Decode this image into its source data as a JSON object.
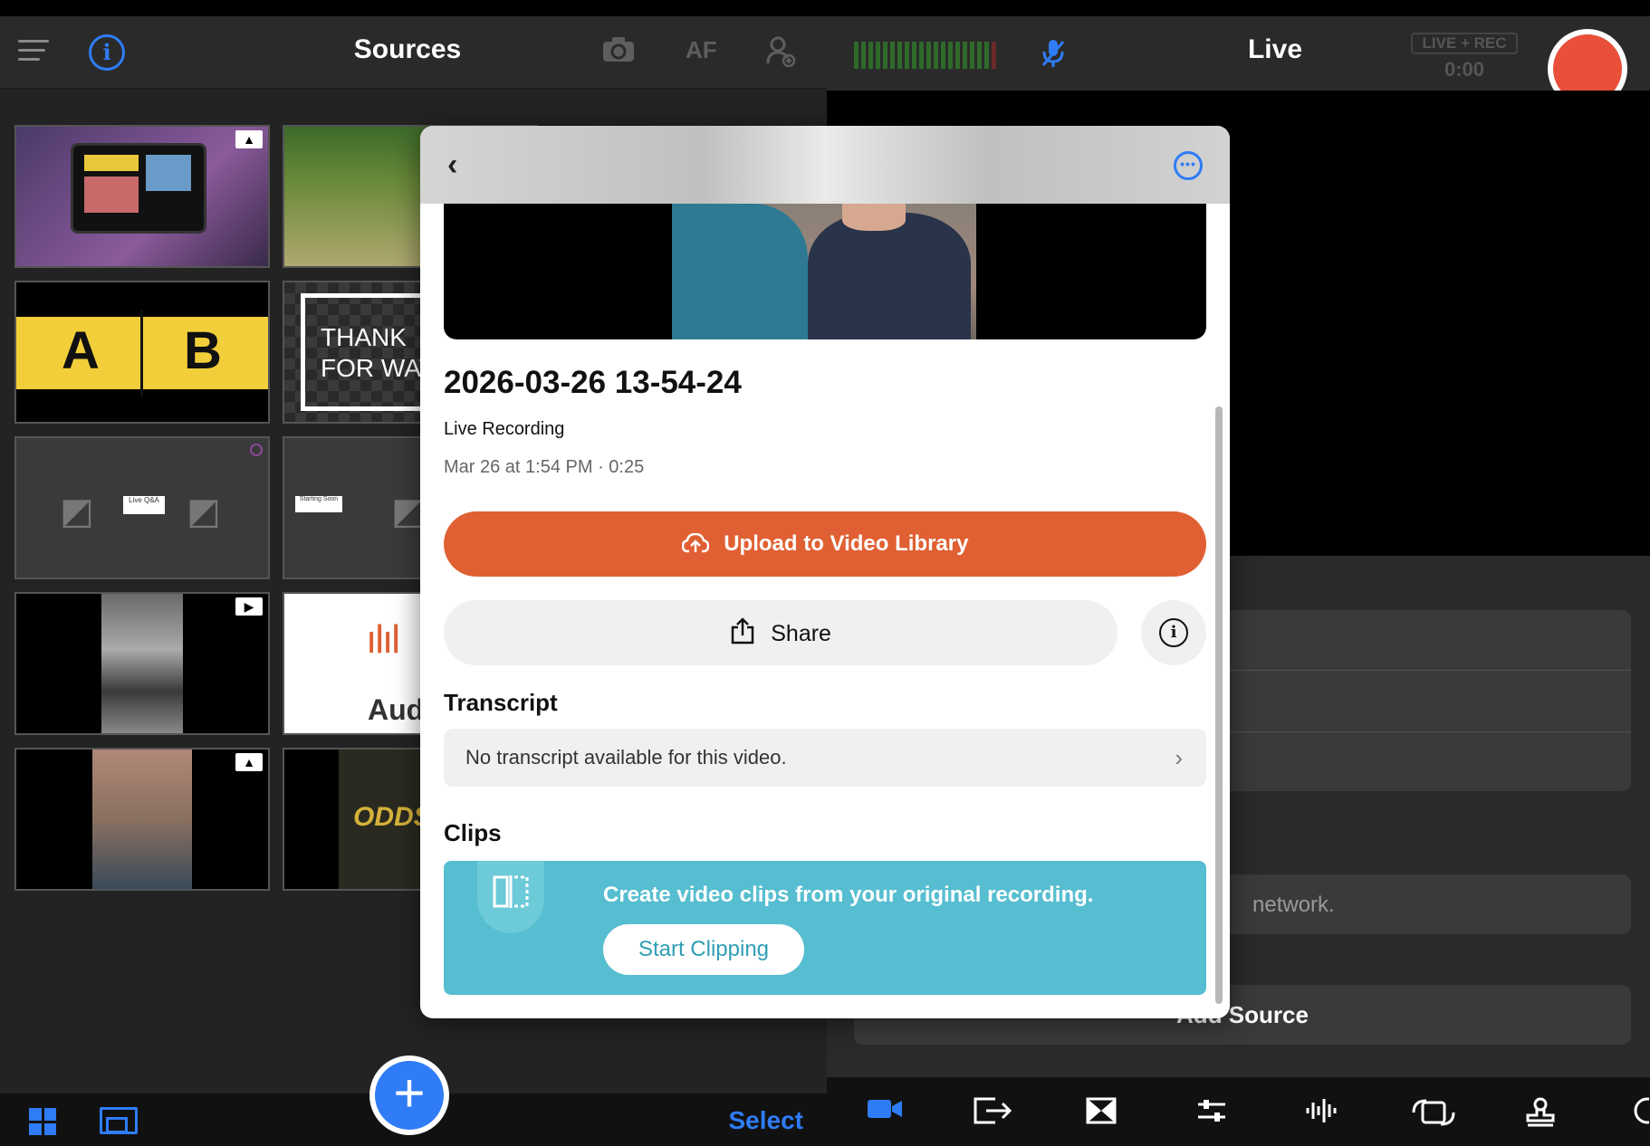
{
  "left_panel": {
    "title": "Sources",
    "header_icons": {
      "menu": "hamburger-icon",
      "info": "i",
      "camera": "camera-flip-icon",
      "af": "AF",
      "add_person": "add-person-icon"
    },
    "tiles": [
      {
        "name": "tablet-photo",
        "badge": "image-icon"
      },
      {
        "name": "wheat-field",
        "badge": ""
      },
      {
        "name": "ab-lower-third",
        "text_a": "A",
        "text_b": "B"
      },
      {
        "name": "thank-you-graphic",
        "text": "THANK\nFOR WAT"
      },
      {
        "name": "live-qa-layout",
        "label": "Live Q&A"
      },
      {
        "name": "starting-soon-layout",
        "label": "Starting Soon"
      },
      {
        "name": "bw-video",
        "badge": "play-icon"
      },
      {
        "name": "audio-source",
        "text": "Aud"
      },
      {
        "name": "family-photo",
        "badge": "image-icon"
      },
      {
        "name": "odds-graphic",
        "text": "ODDS"
      }
    ],
    "bottom": {
      "select_label": "Select",
      "add_label": "+"
    }
  },
  "right_panel": {
    "title": "Live",
    "rec_label": "LIVE + REC",
    "rec_time": "0:00",
    "network_text": "network.",
    "add_source_label": "Add Source",
    "toolbar_icons": [
      "video-camera-icon",
      "output-icon",
      "transition-icon",
      "sliders-icon",
      "audio-waveform-icon",
      "switch-camera-icon",
      "stamp-icon",
      "chat-icon"
    ]
  },
  "modal": {
    "back": "‹",
    "more": "•••",
    "recording_title": "2026-03-26 13-54-24",
    "recording_type": "Live Recording",
    "recording_meta": "Mar 26 at 1:54 PM · 0:25",
    "upload_label": "Upload to Video Library",
    "share_label": "Share",
    "transcript_heading": "Transcript",
    "transcript_text": "No transcript available for this video.",
    "clips_heading": "Clips",
    "clips_text": "Create video clips from your original recording.",
    "clips_button": "Start Clipping"
  },
  "colors": {
    "accent_blue": "#2f7cf6",
    "upload_orange": "#e06033",
    "rec_red": "#e8503a",
    "clips_teal": "#56bed0"
  }
}
